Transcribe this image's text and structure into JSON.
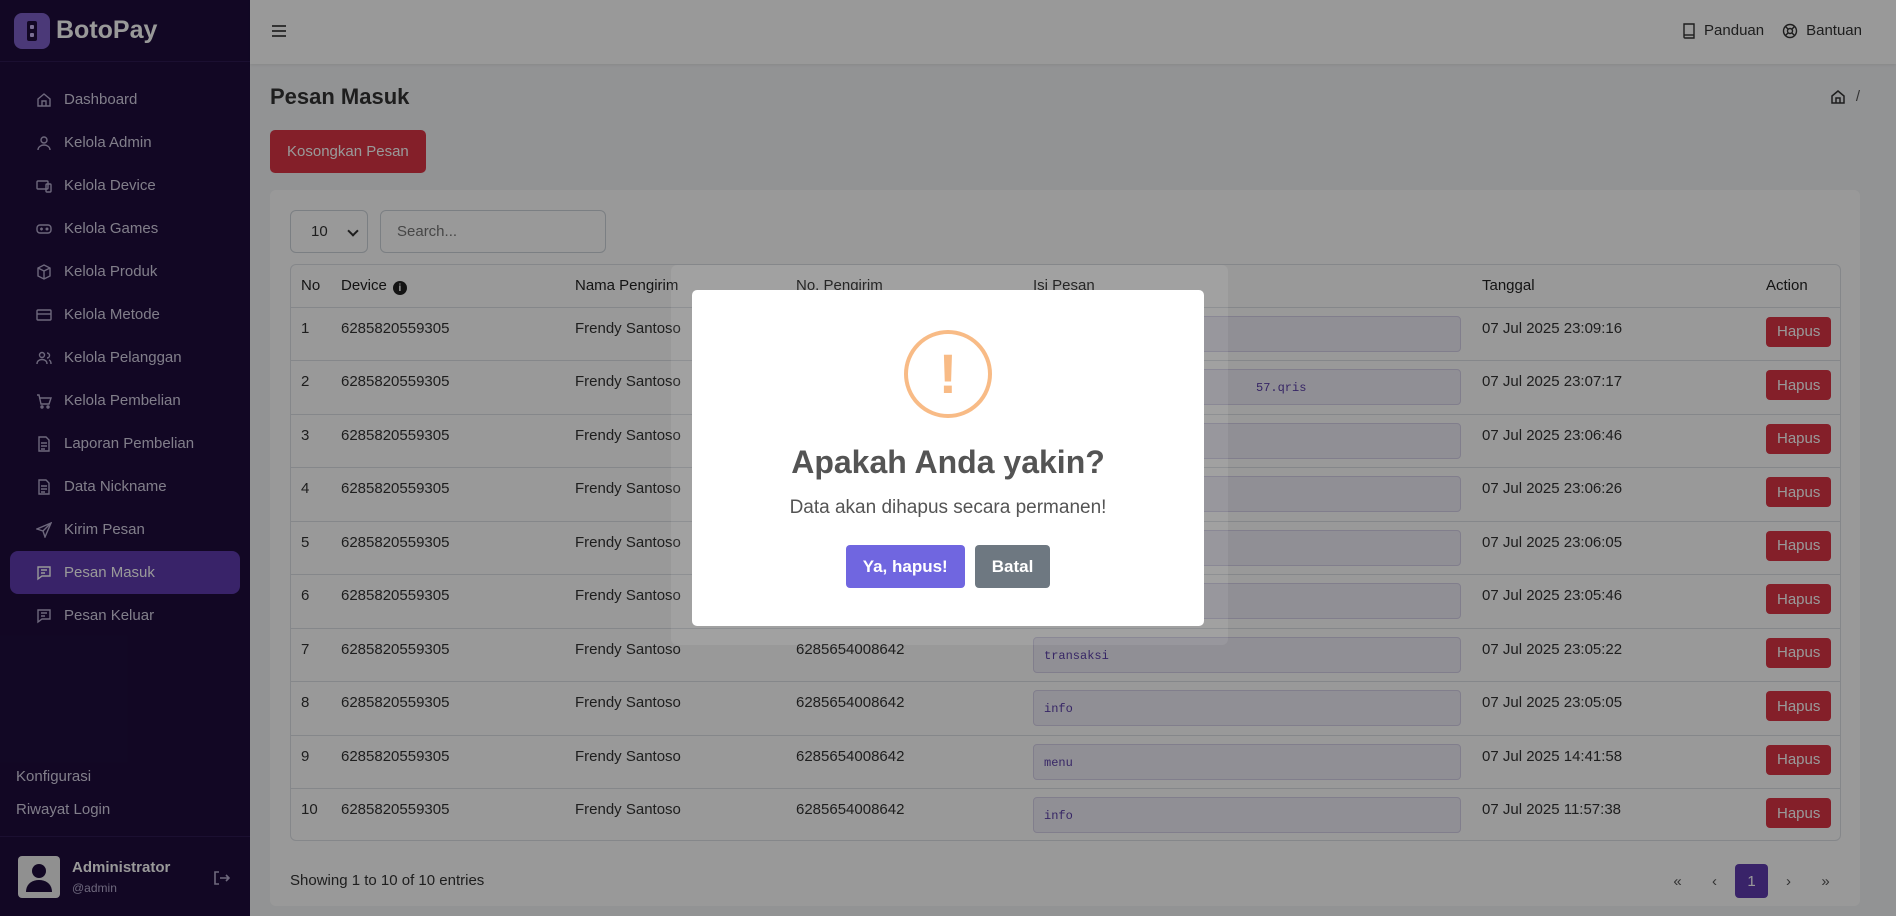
{
  "brand": {
    "name": "BotoPay"
  },
  "sidebar": {
    "items": [
      {
        "label": "Dashboard",
        "icon": "home-icon"
      },
      {
        "label": "Kelola Admin",
        "icon": "user-icon"
      },
      {
        "label": "Kelola Device",
        "icon": "device-icon"
      },
      {
        "label": "Kelola Games",
        "icon": "gamepad-icon"
      },
      {
        "label": "Kelola Produk",
        "icon": "box-icon"
      },
      {
        "label": "Kelola Metode",
        "icon": "credit-card-icon"
      },
      {
        "label": "Kelola Pelanggan",
        "icon": "users-icon"
      },
      {
        "label": "Kelola Pembelian",
        "icon": "cart-icon"
      },
      {
        "label": "Laporan Pembelian",
        "icon": "file-icon"
      },
      {
        "label": "Data Nickname",
        "icon": "file-icon"
      },
      {
        "label": "Kirim Pesan",
        "icon": "send-icon"
      },
      {
        "label": "Pesan Masuk",
        "icon": "message-icon",
        "active": true
      },
      {
        "label": "Pesan Keluar",
        "icon": "message-icon"
      }
    ],
    "bottom_links": [
      "Konfigurasi",
      "Riwayat Login"
    ],
    "user": {
      "name": "Administrator",
      "handle": "@admin"
    }
  },
  "topbar": {
    "links": [
      "Panduan",
      "Bantuan"
    ]
  },
  "main": {
    "title": "Pesan Masuk",
    "breadcrumb_sep": "/",
    "clear_button": "Kosongkan Pesan",
    "page_length": "10",
    "search_placeholder": "Search...",
    "columns": [
      "No",
      "Device",
      "Nama Pengirim",
      "No. Pengirim",
      "Isi Pesan",
      "Tanggal",
      "Action"
    ],
    "rows": [
      {
        "no": "1",
        "device": "6285820559305",
        "sender": "Frendy Santoso",
        "number": "",
        "message": "",
        "date": "07 Jul 2025 23:09:16"
      },
      {
        "no": "2",
        "device": "6285820559305",
        "sender": "Frendy Santoso",
        "number": "",
        "message": "",
        "date": "07 Jul 2025 23:07:17",
        "message_tail": "57.qris"
      },
      {
        "no": "3",
        "device": "6285820559305",
        "sender": "Frendy Santoso",
        "number": "",
        "message": "",
        "date": "07 Jul 2025 23:06:46"
      },
      {
        "no": "4",
        "device": "6285820559305",
        "sender": "Frendy Santoso",
        "number": "",
        "message": "",
        "date": "07 Jul 2025 23:06:26"
      },
      {
        "no": "5",
        "device": "6285820559305",
        "sender": "Frendy Santoso",
        "number": "",
        "message": "",
        "date": "07 Jul 2025 23:06:05"
      },
      {
        "no": "6",
        "device": "6285820559305",
        "sender": "Frendy Santoso",
        "number": "",
        "message": "",
        "date": "07 Jul 2025 23:05:46"
      },
      {
        "no": "7",
        "device": "6285820559305",
        "sender": "Frendy Santoso",
        "number": "6285654008642",
        "message": "transaksi",
        "date": "07 Jul 2025 23:05:22"
      },
      {
        "no": "8",
        "device": "6285820559305",
        "sender": "Frendy Santoso",
        "number": "6285654008642",
        "message": "info",
        "date": "07 Jul 2025 23:05:05"
      },
      {
        "no": "9",
        "device": "6285820559305",
        "sender": "Frendy Santoso",
        "number": "6285654008642",
        "message": "menu",
        "date": "07 Jul 2025 14:41:58"
      },
      {
        "no": "10",
        "device": "6285820559305",
        "sender": "Frendy Santoso",
        "number": "6285654008642",
        "message": "info",
        "date": "07 Jul 2025 11:57:38"
      }
    ],
    "delete_label": "Hapus",
    "footer_info": "Showing 1 to 10 of 10 entries",
    "pager": {
      "first": "«",
      "prev": "‹",
      "current": "1",
      "next": "›",
      "last": "»"
    }
  },
  "modal": {
    "icon": "!",
    "title": "Apakah Anda yakin?",
    "text": "Data akan dihapus secara permanen!",
    "confirm": "Ya, hapus!",
    "cancel": "Batal"
  },
  "colors": {
    "sidebar_bg": "#1e0d3d",
    "accent": "#5f3bb0",
    "danger": "#dc3545",
    "warning": "#f8bb86",
    "confirm": "#7066e0"
  }
}
